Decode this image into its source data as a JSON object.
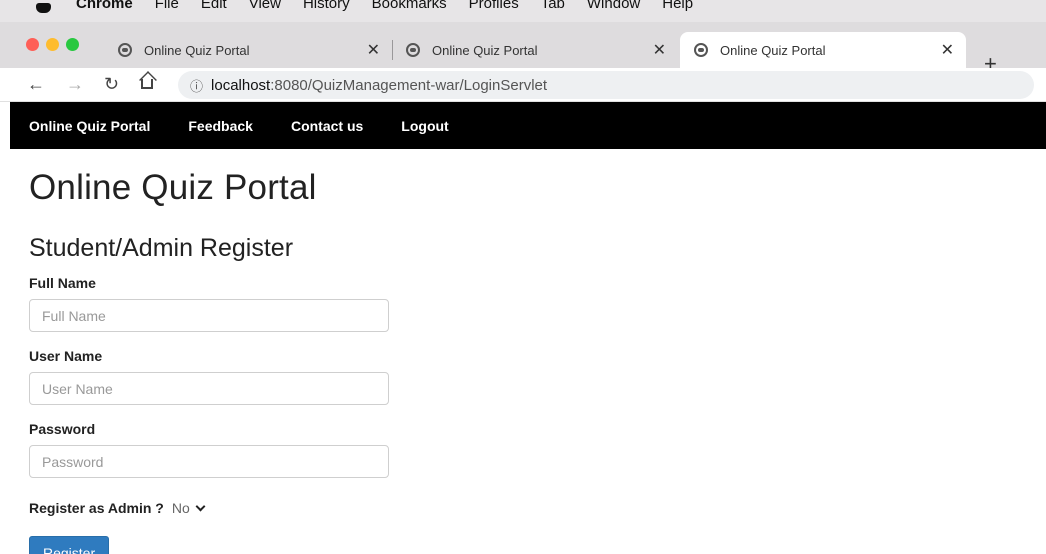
{
  "menubar": {
    "app": "Chrome",
    "items": [
      "File",
      "Edit",
      "View",
      "History",
      "Bookmarks",
      "Profiles",
      "Tab",
      "Window",
      "Help"
    ]
  },
  "tabs": [
    {
      "title": "Online Quiz Portal"
    },
    {
      "title": "Online Quiz Portal"
    },
    {
      "title": "Online Quiz Portal"
    }
  ],
  "address": {
    "host": "localhost",
    "path": ":8080/QuizManagement-war/LoginServlet"
  },
  "sitenav": {
    "items": [
      "Online Quiz Portal",
      "Feedback",
      "Contact us",
      "Logout"
    ]
  },
  "page": {
    "title": "Online Quiz Portal",
    "subtitle": "Student/Admin Register"
  },
  "form": {
    "fullname_label": "Full Name",
    "fullname_placeholder": "Full Name",
    "username_label": "User Name",
    "username_placeholder": "User Name",
    "password_label": "Password",
    "password_placeholder": "Password",
    "admin_label": "Register as Admin ?",
    "admin_value": "No",
    "submit_label": "Register"
  }
}
